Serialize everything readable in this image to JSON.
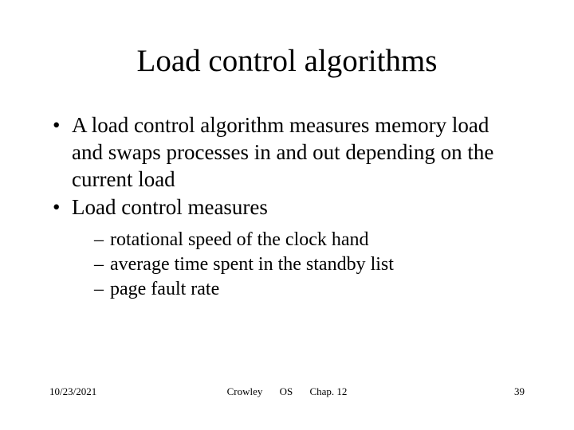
{
  "title": "Load control algorithms",
  "bullets": [
    {
      "text": "A load control algorithm measures memory load and swaps processes in and out depending on the current load"
    },
    {
      "text": "Load control measures",
      "sub": [
        "rotational speed of the clock hand",
        "average time spent in the standby list",
        "page fault rate"
      ]
    }
  ],
  "footer": {
    "date": "10/23/2021",
    "author": "Crowley",
    "course": "OS",
    "chapter": "Chap. 12",
    "page": "39"
  }
}
